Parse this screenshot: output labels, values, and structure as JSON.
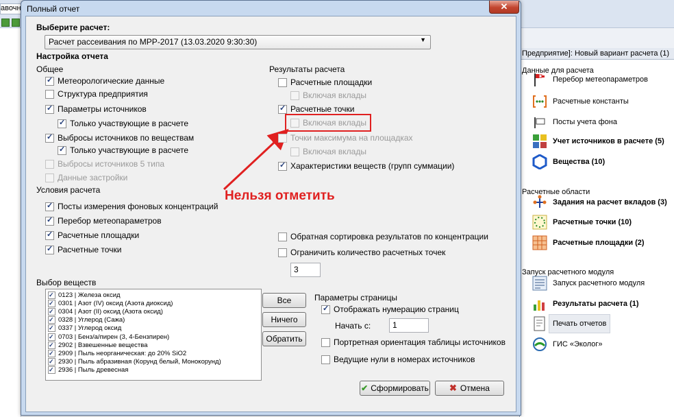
{
  "background": {
    "tab_label": "авочн",
    "right_panel": {
      "header": "Предприятие]: Новый вариант расчета (1)",
      "sections": [
        {
          "title": "Данные для расчета",
          "items": [
            {
              "label": "Перебор метеопараметров",
              "icon": "windsock-icon",
              "bold": false
            },
            {
              "label": "Расчетные константы",
              "icon": "constants-icon",
              "bold": false
            },
            {
              "label": "Посты учета фона",
              "icon": "post-icon",
              "bold": false
            },
            {
              "label": "Учет источников в расчете (5)",
              "icon": "calculator-icon",
              "bold": true
            },
            {
              "label": "Вещества (10)",
              "icon": "hexagon-icon",
              "bold": true
            }
          ]
        },
        {
          "title": "Расчетные области",
          "items": [
            {
              "label": "Задания на расчет вкладов (3)",
              "icon": "nodes-icon",
              "bold": true
            },
            {
              "label": "Расчетные точки (10)",
              "icon": "dots-circle-icon",
              "bold": true
            },
            {
              "label": "Расчетные площадки (2)",
              "icon": "grid-icon",
              "bold": true
            }
          ]
        },
        {
          "title": "Запуск расчетного модуля",
          "items": [
            {
              "label": "Запуск расчетного модуля",
              "icon": "run-icon",
              "bold": false
            },
            {
              "label": "Результаты расчета (1)",
              "icon": "bar-chart-icon",
              "bold": true
            },
            {
              "label": "Печать отчетов",
              "icon": "report-icon",
              "bold": false
            },
            {
              "label": "ГИС «Эколог»",
              "icon": "globe-icon",
              "bold": false
            }
          ]
        }
      ]
    }
  },
  "dialog": {
    "title": "Полный отчет",
    "close_glyph": "✕",
    "select_calc_label": "Выберите расчет:",
    "calc_value": "Расчет рассеивания по МРР-2017 (13.03.2020 9:30:30)",
    "report_setup_label": "Настройка отчета",
    "general": {
      "title": "Общее",
      "items": [
        {
          "label": "Метеорологические данные",
          "checked": true,
          "disabled": false
        },
        {
          "label": "Структура предприятия",
          "checked": false,
          "disabled": false
        },
        {
          "label": "Параметры источников",
          "checked": true,
          "disabled": false
        },
        {
          "label": "Только участвующие в расчете",
          "checked": true,
          "disabled": false
        },
        {
          "label": "Выбросы источников по веществам",
          "checked": true,
          "disabled": false
        },
        {
          "label": "Только участвующие в расчете",
          "checked": true,
          "disabled": false
        },
        {
          "label": "Выбросы источников 5 типа",
          "checked": false,
          "disabled": true
        },
        {
          "label": "Данные застройки",
          "checked": false,
          "disabled": true
        }
      ]
    },
    "conditions": {
      "title": "Условия расчета",
      "items": [
        {
          "label": "Посты измерения фоновых концентраций",
          "checked": true,
          "disabled": false
        },
        {
          "label": "Перебор метеопараметров",
          "checked": true,
          "disabled": false
        },
        {
          "label": "Расчетные площадки",
          "checked": true,
          "disabled": false
        },
        {
          "label": "Расчетные точки",
          "checked": true,
          "disabled": false
        }
      ]
    },
    "results": {
      "title": "Результаты расчета",
      "items": [
        {
          "label": "Расчетные площадки",
          "checked": false,
          "disabled": false
        },
        {
          "label": "Включая вклады",
          "checked": false,
          "disabled": true
        },
        {
          "label": "Расчетные точки",
          "checked": true,
          "disabled": false
        },
        {
          "label": "Включая вклады",
          "checked": false,
          "disabled": true
        },
        {
          "label": "Точки максимума на площадках",
          "checked": false,
          "disabled": true
        },
        {
          "label": "Включая вклады",
          "checked": false,
          "disabled": true
        },
        {
          "label": "Характеристики  веществ (групп суммации)",
          "checked": true,
          "disabled": false
        }
      ]
    },
    "reverse_sort": {
      "label": "Обратная сортировка результатов по концентрации",
      "checked": false
    },
    "limit_points": {
      "label": "Ограничить количество расчетных точек",
      "checked": false
    },
    "limit_value": "3",
    "annotation": {
      "text": "Нельзя отметить",
      "color": "#e02020"
    },
    "substances": {
      "title": "Выбор веществ",
      "items": [
        "0123 | Железа оксид",
        "0301 | Азот (IV) оксид (Азота диоксид)",
        "0304 | Азот (II) оксид (Азота оксид)",
        "0328 | Углерод (Сажа)",
        "0337 | Углерод оксид",
        "0703 | Бенз/а/пирен  (3, 4-Бензпирен)",
        "2902 | Взвешенные вещества",
        "2909 | Пыль неорганическая: до 20% SiO2",
        "2930 | Пыль абразивная (Корунд белый, Монокорунд)",
        "2936 | Пыль древесная"
      ],
      "btn_all": "Все",
      "btn_none": "Ничего",
      "btn_invert": "Обратить"
    },
    "page_params": {
      "title": "Параметры страницы",
      "numbering": {
        "label": "Отображать нумерацию страниц",
        "checked": true
      },
      "start_label": "Начать с:",
      "start_value": "1",
      "portrait": {
        "label": "Портретная ориентация таблицы источников",
        "checked": false
      },
      "leading_zeros": {
        "label": "Ведущие нули в номерах источников",
        "checked": false
      }
    },
    "btn_ok": "Сформировать",
    "btn_cancel": "Отмена"
  }
}
